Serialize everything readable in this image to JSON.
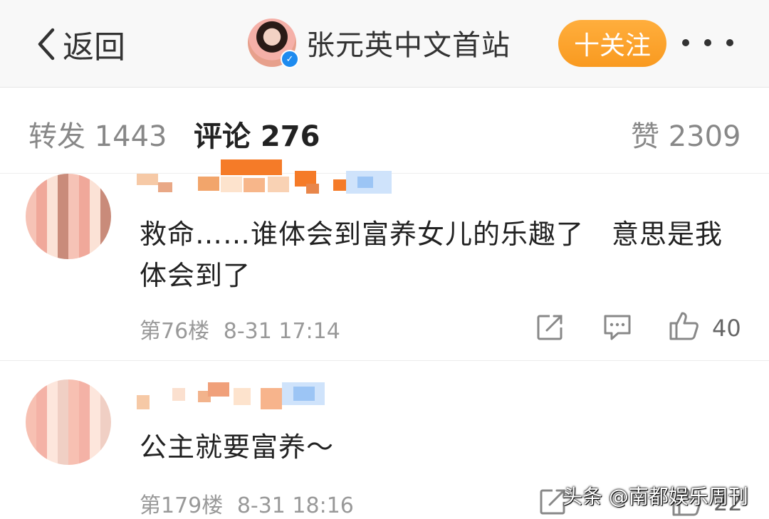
{
  "header": {
    "back_label": "返回",
    "account_name": "张元英中文首站",
    "follow_label": "十关注"
  },
  "tabs": [
    {
      "label": "转发 1443"
    },
    {
      "label": "评论 276"
    },
    {
      "label": "赞 2309"
    }
  ],
  "comments": [
    {
      "text": "救命……谁体会到富养女儿的乐趣了　意思是我体会到了",
      "floor": "第76楼",
      "time": "8-31 17:14",
      "likes": "40"
    },
    {
      "text": "公主就要富养～",
      "floor": "第179楼",
      "time": "8-31 18:16",
      "likes": "22"
    }
  ],
  "watermark": "头条 @南都娱乐周刊",
  "colors": {
    "follow_button": "#F99A20",
    "verified_badge": "#1E8BEF",
    "meta_text": "#999999"
  },
  "icons": [
    "back-chevron-icon",
    "verified-icon",
    "more-dots-icon",
    "repost-icon",
    "comment-icon",
    "like-icon"
  ]
}
